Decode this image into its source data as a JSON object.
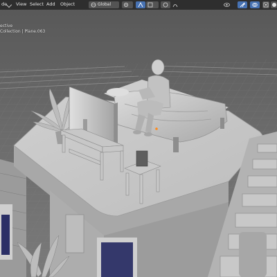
{
  "header": {
    "mode_label": "de",
    "menu": [
      "View",
      "Select",
      "Add",
      "Object"
    ],
    "transform_orientation": "Global"
  },
  "viewport_info": {
    "line1": "ective",
    "line2": "Collection | Plane.063"
  },
  "icons": [
    "editor-mode-icon",
    "orientation-icon",
    "pivot-icon",
    "snap-icon",
    "snap-target-icon",
    "proportional-icon",
    "falloff-icon",
    "visibility-icon",
    "gizmo-icon",
    "overlay-icon",
    "xray-icon",
    "shading-solid-icon"
  ],
  "colors": {
    "header_bg": "#2a2a2a",
    "viewport_bg": "#3d3d3d",
    "active_button": "#4772b3",
    "clay": "#b7b7b7"
  }
}
